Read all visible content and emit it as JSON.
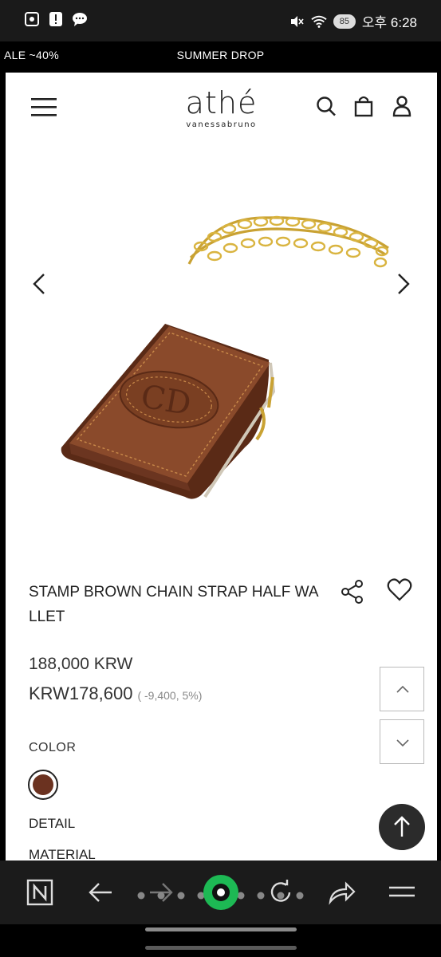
{
  "status_bar": {
    "time": "오후 6:28",
    "battery": "85"
  },
  "promo": {
    "left_text": "ALE ~40%",
    "center_text": "SUMMER DROP"
  },
  "header": {
    "brand": "athé",
    "brand_sub": "vanessabruno"
  },
  "product": {
    "title": "STAMP BROWN CHAIN STRAP HALF WA LLET",
    "original_price": "188,000 KRW",
    "sale_price": "KRW178,600",
    "discount": "( -9,400, 5%)",
    "color_label": "COLOR",
    "color_swatch": "#6b3220",
    "detail_label": "DETAIL",
    "material_label": "MATERIAL"
  },
  "colors": {
    "accent_green": "#1db954",
    "wallet_brown": "#8a4a2b",
    "chain_gold": "#c9a233"
  }
}
